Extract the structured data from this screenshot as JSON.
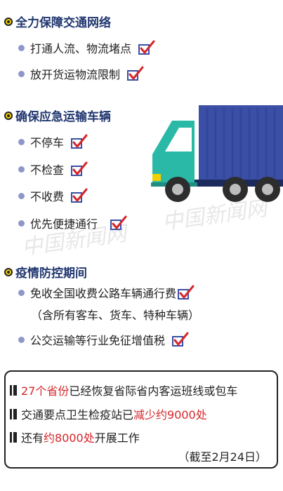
{
  "sections": [
    {
      "title": "全力保障交通网络",
      "items": [
        "打通人流、物流堵点",
        "放开货运物流限制"
      ]
    },
    {
      "title": "确保应急运输车辆",
      "items": [
        "不停车",
        "不检查",
        "不收费",
        "优先便捷通行"
      ]
    },
    {
      "title": "疫情防控期间",
      "items": [
        "免收全国收费公路车辆通行费",
        "公交运输等行业免征增值税"
      ],
      "subnote": "（含所有客车、货车、特种车辆）"
    }
  ],
  "stats": {
    "line1": {
      "highlight": "27个省份",
      "rest": "已经恢复省际省内客运班线或包车"
    },
    "line2": {
      "pre": "交通要点卫生检疫站已",
      "highlight": "减少约9000处"
    },
    "line3": {
      "pre": "还有",
      "highlight": "约8000处",
      "post": "开展工作"
    },
    "date": "（截至2月24日）"
  },
  "icons": {
    "section_marker": "target-bullet-icon",
    "item_check": "check-box-icon",
    "illustration": "truck-icon"
  },
  "colors": {
    "title": "#21376f",
    "highlight": "#d7262a",
    "bullet_dot": "#8e97c8",
    "truck_cab": "#2bb9a7",
    "truck_cargo": "#3a4fa5"
  }
}
